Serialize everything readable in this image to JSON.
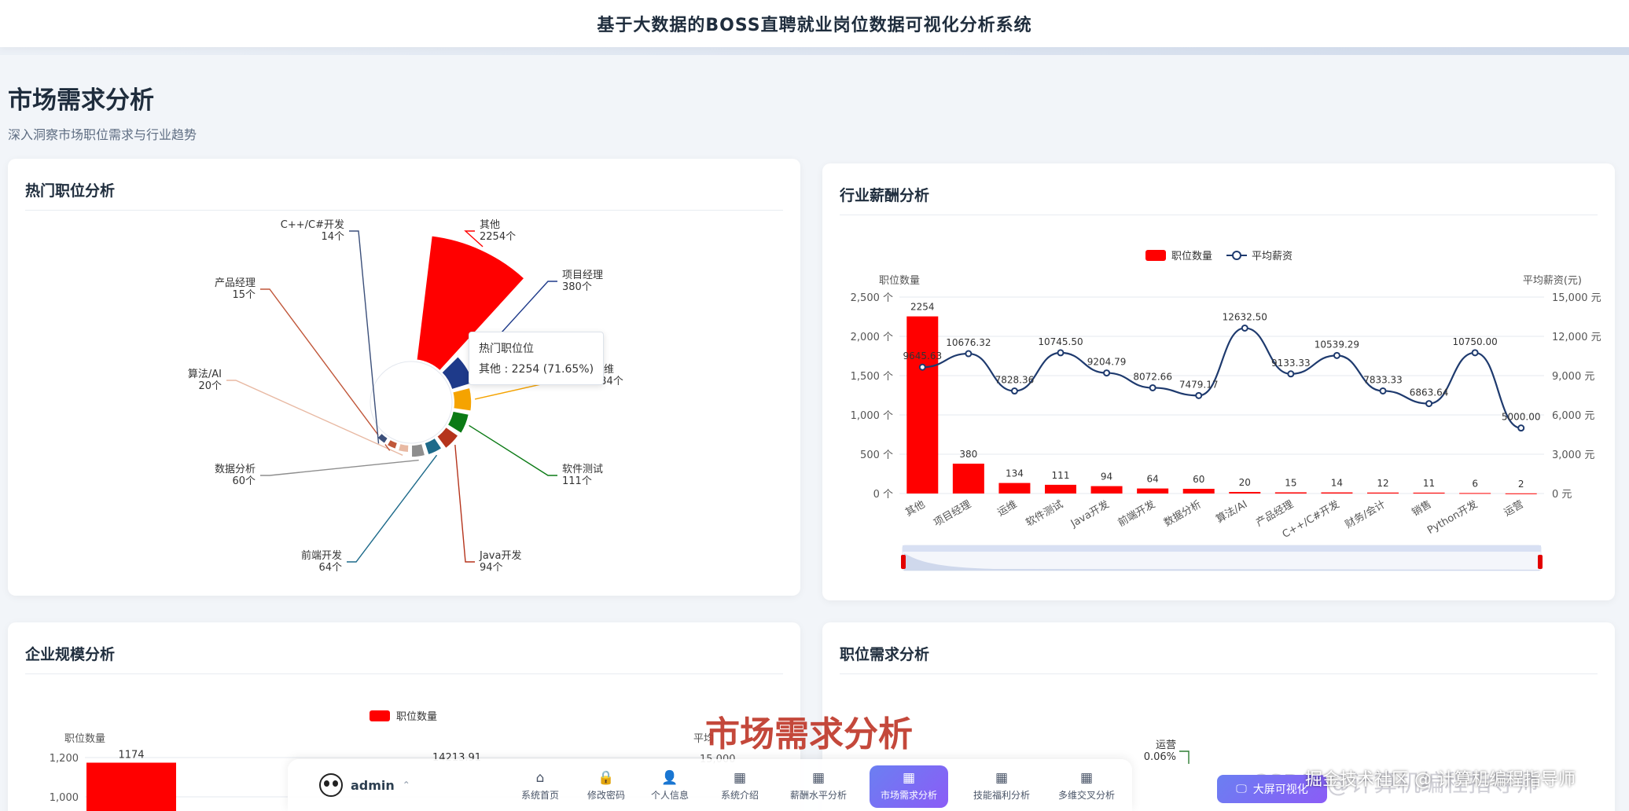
{
  "app": {
    "title": "基于大数据的BOSS直聘就业岗位数据可视化分析系统"
  },
  "page": {
    "title": "市场需求分析",
    "subtitle": "深入洞察市场职位需求与行业趋势"
  },
  "cards": {
    "hot_jobs": "热门职位分析",
    "industry_salary": "行业薪酬分析",
    "company_scale": "企业规模分析",
    "job_demand": "职位需求分析"
  },
  "tooltip": {
    "title": "热门职位位",
    "label": "其他",
    "value": "2254",
    "percent": "71.65%"
  },
  "chart_data": [
    {
      "type": "pie",
      "title": "热门职位分析",
      "style": "rose",
      "unit": "个",
      "slices": [
        {
          "name": "其他",
          "value": 2254,
          "color": "#ff0000"
        },
        {
          "name": "项目经理",
          "value": 380,
          "color": "#1e3a8a"
        },
        {
          "name": "运维",
          "value": 134,
          "color": "#f5a300"
        },
        {
          "name": "软件测试",
          "value": 111,
          "color": "#0b7a15"
        },
        {
          "name": "Java开发",
          "value": 94,
          "color": "#b5341c"
        },
        {
          "name": "前端开发",
          "value": 64,
          "color": "#1d6a8a"
        },
        {
          "name": "数据分析",
          "value": 60,
          "color": "#8e8e8e"
        },
        {
          "name": "算法/AI",
          "value": 20,
          "color": "#e8b9a3"
        },
        {
          "name": "产品经理",
          "value": 15,
          "color": "#c0573a"
        },
        {
          "name": "C++/C#开发",
          "value": 14,
          "color": "#3b4f7a"
        }
      ]
    },
    {
      "type": "bar",
      "title": "行业薪酬分析",
      "legend": [
        "职位数量",
        "平均薪资"
      ],
      "legend_position": "top-center",
      "ylabel_left": "职位数量",
      "ylabel_right": "平均薪资(元)",
      "ylim_left": [
        0,
        2500
      ],
      "ylim_right": [
        0,
        15000
      ],
      "yticks_left": [
        "0 个",
        "500 个",
        "1,000 个",
        "1,500 个",
        "2,000 个",
        "2,500 个"
      ],
      "yticks_right": [
        "0 元",
        "3,000 元",
        "6,000 元",
        "9,000 元",
        "12,000 元",
        "15,000 元"
      ],
      "categories": [
        "其他",
        "项目经理",
        "运维",
        "软件测试",
        "Java开发",
        "前端开发",
        "数据分析",
        "算法/AI",
        "产品经理",
        "C++/C#开发",
        "财务/会计",
        "销售",
        "Python开发",
        "运营"
      ],
      "series": [
        {
          "name": "职位数量",
          "type": "bar",
          "color": "#ff0000",
          "values": [
            2254,
            380,
            134,
            111,
            94,
            64,
            60,
            20,
            15,
            14,
            12,
            11,
            6,
            2
          ]
        },
        {
          "name": "平均薪资",
          "type": "line",
          "color": "#1e3a6e",
          "values": [
            9645.63,
            10676.32,
            7828.36,
            10745.5,
            9204.79,
            8072.66,
            7479.17,
            12632.5,
            9133.33,
            10539.29,
            7833.33,
            6863.64,
            10750.0,
            5000.0
          ]
        }
      ],
      "salary_labels": [
        "9645.63",
        "10676.32",
        "7828.36",
        "10745.50",
        "9204.79",
        "8072.66",
        "7479.17",
        "12632.50",
        "9133.33",
        "10539.29",
        "7833.33",
        "6863.64",
        "10750.00",
        "5000.00"
      ]
    },
    {
      "type": "bar",
      "title": "企业规模分析",
      "legend": [
        "职位数量"
      ],
      "ylabel_left": "职位数量",
      "yticks_left": [
        "1,000",
        "1,200"
      ],
      "first_value": 1174,
      "partial_labels": [
        "14213.91",
        "15,000"
      ],
      "partial_axis": "平均"
    },
    {
      "type": "bar",
      "title": "职位需求分析",
      "partial_labels": [
        "运营",
        "0.06%"
      ]
    }
  ],
  "overlay": {
    "caption": "市场需求分析",
    "watermark": "CSDN @计算机编程指导师",
    "juejin": "掘金技术社区 @ 计算机编程指导师"
  },
  "dock": {
    "username": "admin",
    "items": [
      {
        "label": "系统首页",
        "icon": "⌂",
        "icon_name": "home-icon"
      },
      {
        "label": "修改密码",
        "icon": "🔒",
        "icon_name": "lock-icon"
      },
      {
        "label": "个人信息",
        "icon": "👤",
        "icon_name": "user-icon"
      },
      {
        "label": "系统介绍",
        "icon": "▦",
        "icon_name": "grid-icon"
      },
      {
        "label": "薪酬水平分析",
        "icon": "▦",
        "icon_name": "grid-icon"
      },
      {
        "label": "市场需求分析",
        "icon": "▦",
        "icon_name": "grid-icon",
        "active": true
      },
      {
        "label": "技能福利分析",
        "icon": "▦",
        "icon_name": "grid-icon"
      },
      {
        "label": "多维交叉分析",
        "icon": "▦",
        "icon_name": "grid-icon"
      }
    ],
    "bigscreen_label": "大屏可视化"
  }
}
